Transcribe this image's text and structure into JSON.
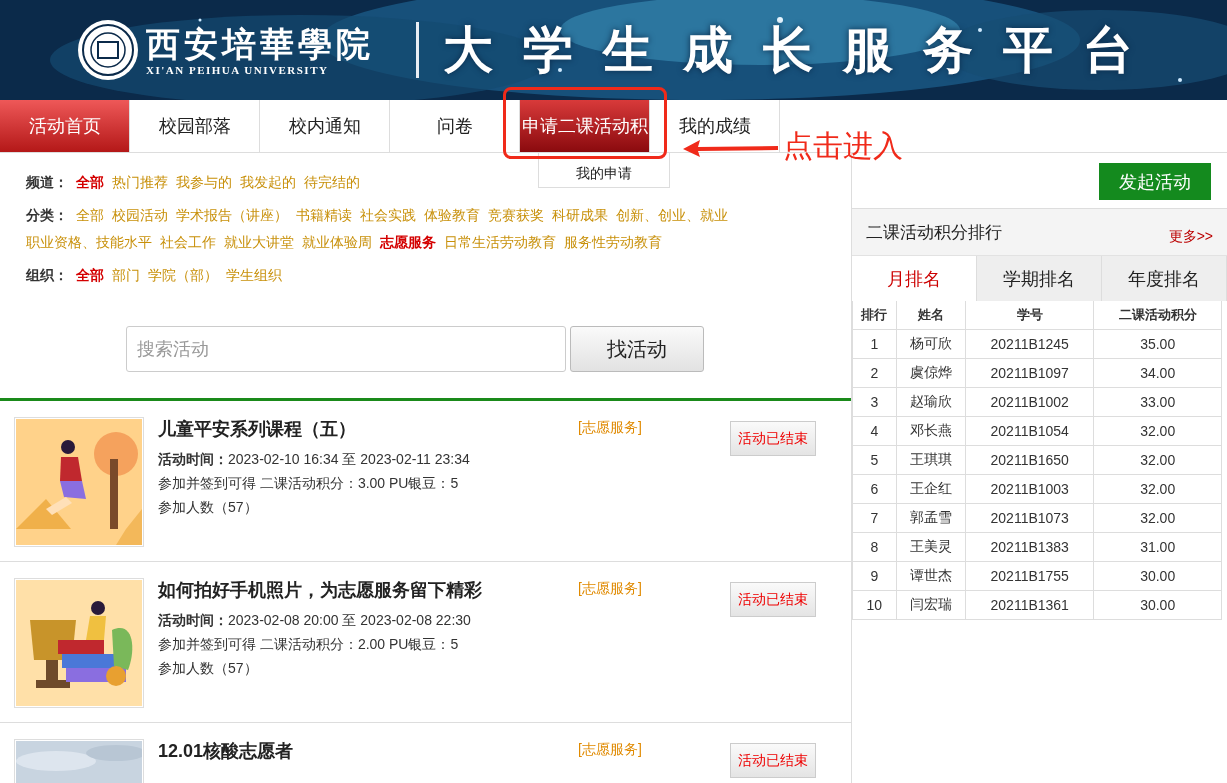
{
  "header": {
    "school_name": "西安培華學院",
    "school_name_en": "XI'AN PEIHUA UNIVERSITY",
    "platform_title": "大学生成长服务平台"
  },
  "nav": {
    "tabs": [
      {
        "label": "活动首页",
        "selected": true,
        "hovered": false
      },
      {
        "label": "校园部落",
        "selected": false,
        "hovered": false
      },
      {
        "label": "校内通知",
        "selected": false,
        "hovered": false
      },
      {
        "label": "问卷",
        "selected": false,
        "hovered": false
      },
      {
        "label": "申请二课活动积",
        "selected": false,
        "hovered": true,
        "submenu": [
          "我的申请"
        ]
      },
      {
        "label": "我的成绩",
        "selected": false,
        "hovered": false
      }
    ]
  },
  "annotation": {
    "text": "点击进入"
  },
  "filters": [
    {
      "label": "频道：",
      "items": [
        {
          "label": "全部",
          "selected": true
        },
        {
          "label": "热门推荐",
          "selected": false
        },
        {
          "label": "我参与的",
          "selected": false
        },
        {
          "label": "我发起的",
          "selected": false
        },
        {
          "label": "待完结的",
          "selected": false
        }
      ]
    },
    {
      "label": "分类：",
      "items": [
        {
          "label": "全部",
          "selected": false
        },
        {
          "label": "校园活动",
          "selected": false
        },
        {
          "label": "学术报告（讲座）",
          "selected": false
        },
        {
          "label": "书籍精读",
          "selected": false
        },
        {
          "label": "社会实践",
          "selected": false
        },
        {
          "label": "体验教育",
          "selected": false
        },
        {
          "label": "竞赛获奖",
          "selected": false
        },
        {
          "label": "科研成果",
          "selected": false
        },
        {
          "label": "创新、创业、就业",
          "selected": false
        },
        {
          "label": "职业资格、技能水平",
          "selected": false
        },
        {
          "label": "社会工作",
          "selected": false
        },
        {
          "label": "就业大讲堂",
          "selected": false
        },
        {
          "label": "就业体验周",
          "selected": false
        },
        {
          "label": "志愿服务",
          "selected": true
        },
        {
          "label": "日常生活劳动教育",
          "selected": false
        },
        {
          "label": "服务性劳动教育",
          "selected": false
        }
      ]
    },
    {
      "label": "组织：",
      "items": [
        {
          "label": "全部",
          "selected": true
        },
        {
          "label": "部门",
          "selected": false
        },
        {
          "label": "学院（部）",
          "selected": false
        },
        {
          "label": "学生组织",
          "selected": false
        }
      ]
    }
  ],
  "search": {
    "placeholder": "搜索活动",
    "button": "找活动"
  },
  "activities": [
    {
      "title": "儿童平安系列课程（五）",
      "tag": "[志愿服务]",
      "status": "活动已结束",
      "time_label": "活动时间：",
      "time": "2023-02-10 16:34 至 2023-02-11 23:34",
      "reward": "参加并签到可得 二课活动积分：3.00 PU银豆：5",
      "participants": "参加人数（57）",
      "kind": "picture"
    },
    {
      "title": "如何拍好手机照片，为志愿服务留下精彩",
      "tag": "[志愿服务]",
      "status": "活动已结束",
      "time_label": "活动时间：",
      "time": "2023-02-08 20:00 至 2023-02-08 22:30",
      "reward": "参加并签到可得 二课活动积分：2.00 PU银豆：5",
      "participants": "参加人数（57）",
      "kind": "picture"
    },
    {
      "title": "12.01核酸志愿者",
      "tag": "[志愿服务]",
      "status": "活动已结束",
      "kind": "picture"
    }
  ],
  "sidebar": {
    "start_button": "发起活动",
    "ranking": {
      "title": "二课活动积分排行",
      "more": "更多>>",
      "tabs": [
        {
          "label": "月排名",
          "selected": true
        },
        {
          "label": "学期排名",
          "selected": false
        },
        {
          "label": "年度排名",
          "selected": false
        }
      ],
      "columns": [
        "排行",
        "姓名",
        "学号",
        "二课活动积分"
      ],
      "rows": [
        [
          "1",
          "杨可欣",
          "20211B1245",
          "35.00"
        ],
        [
          "2",
          "虞倞烨",
          "20211B1097",
          "34.00"
        ],
        [
          "3",
          "赵瑜欣",
          "20211B1002",
          "33.00"
        ],
        [
          "4",
          "邓长燕",
          "20211B1054",
          "32.00"
        ],
        [
          "5",
          "王琪琪",
          "20211B1650",
          "32.00"
        ],
        [
          "6",
          "王企红",
          "20211B1003",
          "32.00"
        ],
        [
          "7",
          "郭孟雪",
          "20211B1073",
          "32.00"
        ],
        [
          "8",
          "王美灵",
          "20211B1383",
          "31.00"
        ],
        [
          "9",
          "谭世杰",
          "20211B1755",
          "30.00"
        ],
        [
          "10",
          "闫宏瑞",
          "20211B1361",
          "30.00"
        ]
      ]
    }
  }
}
